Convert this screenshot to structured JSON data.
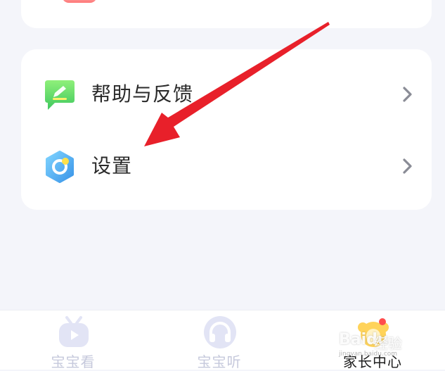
{
  "menu": {
    "items": [
      {
        "label": "帮助与反馈",
        "icon": "feedback-chat-icon",
        "color": "#5fd86a"
      },
      {
        "label": "设置",
        "icon": "settings-hexagon-icon",
        "color": "#5ab6f2"
      }
    ]
  },
  "tabbar": {
    "tabs": [
      {
        "label": "宝宝看",
        "icon": "tv-icon",
        "active": false
      },
      {
        "label": "宝宝听",
        "icon": "headphones-icon",
        "active": false
      },
      {
        "label": "家长中心",
        "icon": "parent-center-icon",
        "active": true
      }
    ]
  },
  "watermark": {
    "brand": "Baidu",
    "suffix": "经验",
    "url": "jingyan.baidu.com"
  },
  "colors": {
    "background": "#f4f5fa",
    "card": "#ffffff",
    "annotation_arrow": "#e8202a",
    "tab_inactive": "#c6c9dc",
    "tab_active": "#1e1e1e"
  }
}
